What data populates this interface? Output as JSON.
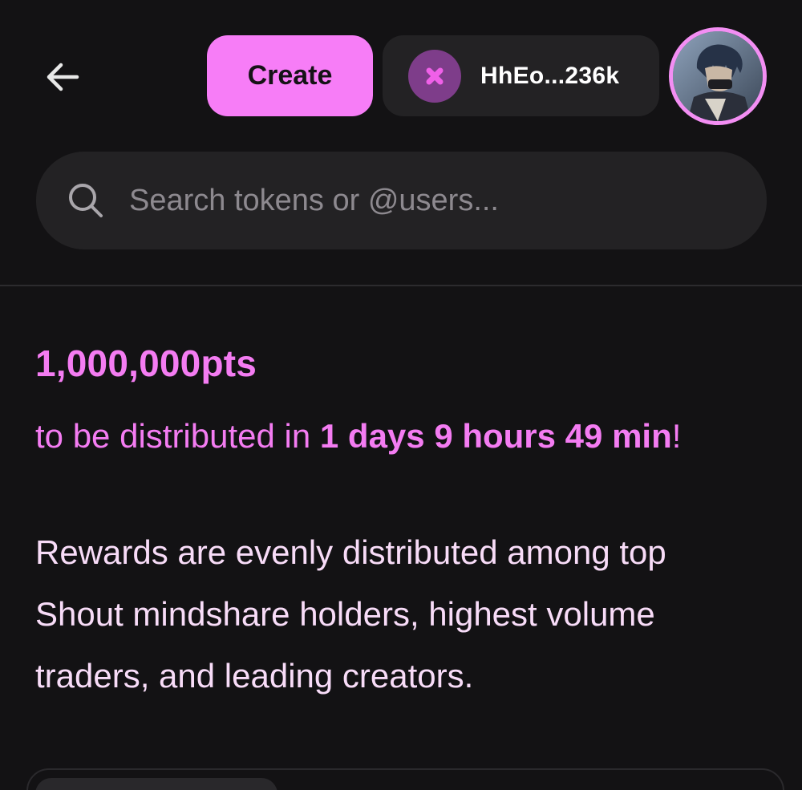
{
  "header": {
    "back_icon": "arrow-left-icon",
    "create_label": "Create",
    "wallet": {
      "icon": "close-x-icon",
      "address": "HhEo...236k"
    },
    "avatar_icon": "user-avatar"
  },
  "search": {
    "placeholder": "Search tokens or @users...",
    "value": ""
  },
  "rewards": {
    "points": "1,000,000pts",
    "prefix": "to be distributed in ",
    "countdown": "1 days 9 hours 49 min",
    "suffix": "!",
    "description": "Rewards are evenly distributed among top Shout mindshare holders, highest volume traders, and leading creators."
  },
  "colors": {
    "background": "#131214",
    "accent": "#f77df7",
    "surface": "#232224",
    "text_light": "#f8dcf8"
  }
}
